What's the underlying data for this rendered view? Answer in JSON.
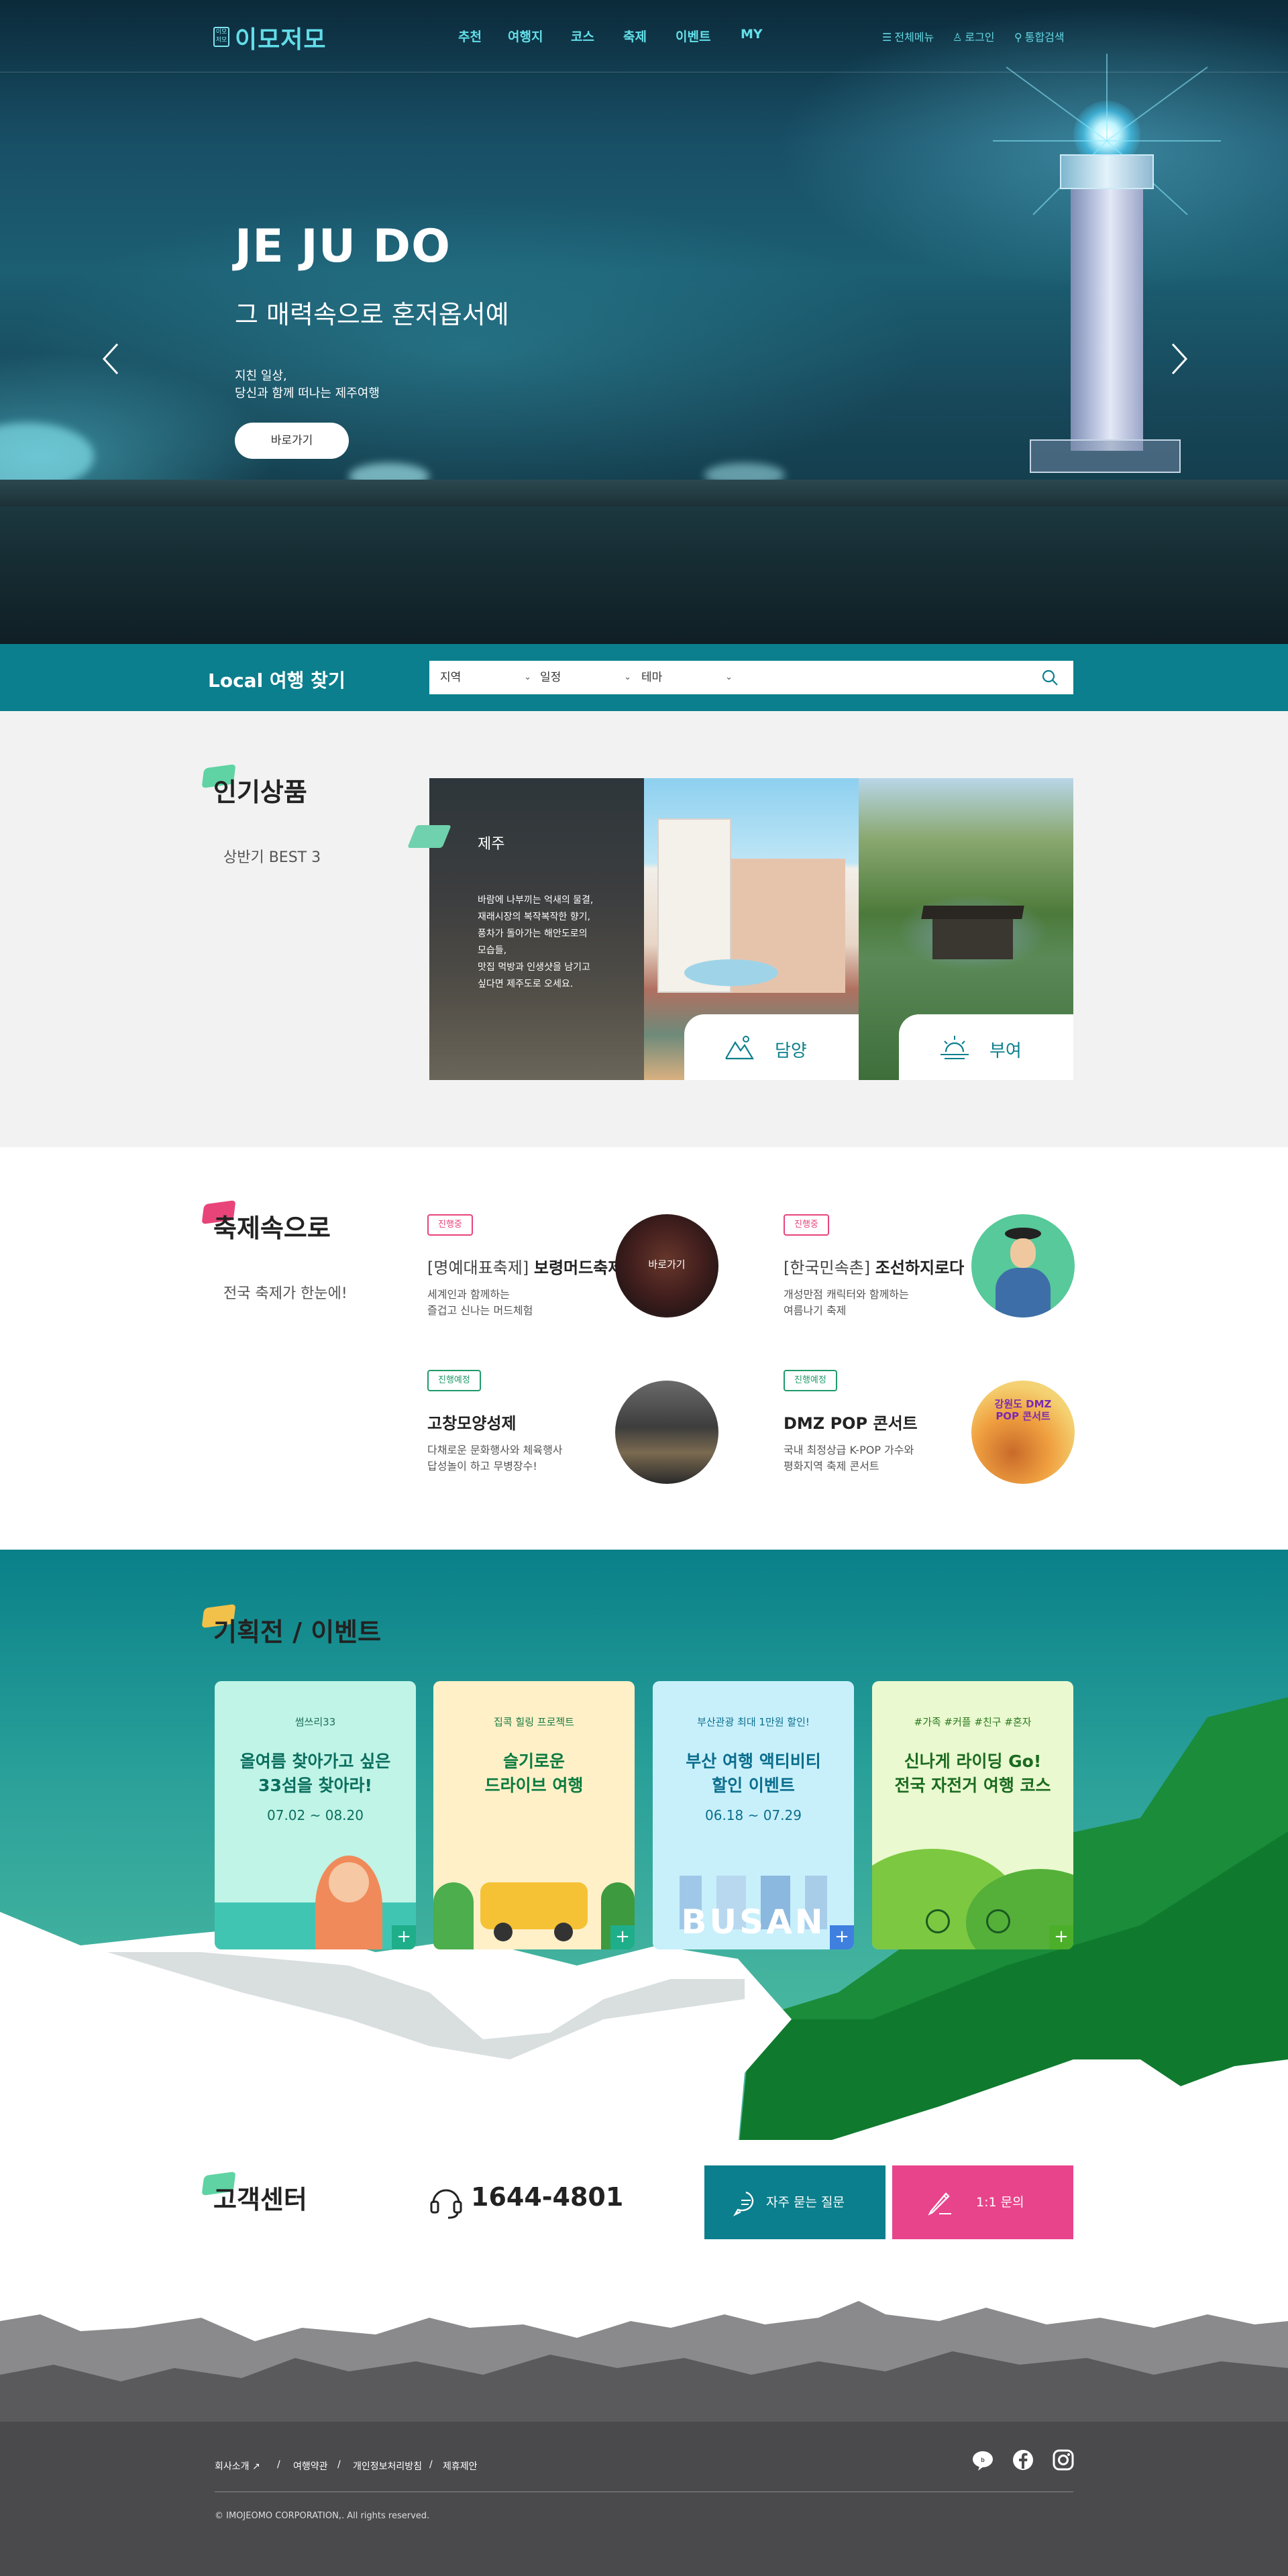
{
  "header": {
    "logo_mark": "이모\n저모",
    "logo_text": "이모저모",
    "nav": [
      "추천",
      "여행지",
      "코스",
      "축제",
      "이벤트",
      "MY"
    ],
    "util": {
      "menu": "전체메뉴",
      "login": "로그인",
      "search": "통합검색"
    }
  },
  "hero": {
    "title": "JE JU DO",
    "subtitle": "그 매력속으로 혼저옵서예",
    "desc_line1": "지친 일상,",
    "desc_line2": "당신과 함께 떠나는 제주여행",
    "button": "바로가기"
  },
  "search": {
    "title": "Local 여행 찾기",
    "selects": [
      "지역",
      "일정",
      "테마"
    ]
  },
  "popular": {
    "title": "인기상품",
    "subtitle": "상반기 BEST 3",
    "featured": {
      "title": "제주",
      "lines": [
        "바람에 나부끼는 억새의 물결,",
        "재래시장의 복작복작한 향기,",
        "풍차가 돌아가는 해안도로의",
        "모습들,",
        "맛집 먹방과 인생샷을 남기고",
        "싶다면 제주도로 오세요."
      ]
    },
    "cards": [
      {
        "label": "담양",
        "icon": "mountain-icon"
      },
      {
        "label": "부여",
        "icon": "sunrise-icon"
      }
    ]
  },
  "festival": {
    "title": "축제속으로",
    "subtitle": "전국 축제가 한눈에!",
    "items": [
      {
        "tag": "진행중",
        "prefix": "[명예대표축제]",
        "name": "보령머드축제",
        "desc1": "세계인과 함께하는",
        "desc2": "즐겁고 신나는 머드체험",
        "overlay": "바로가기"
      },
      {
        "tag": "진행중",
        "prefix": "[한국민속촌]",
        "name": "조선하지로다",
        "desc1": "개성만점 캐릭터와 함께하는",
        "desc2": "여름나기 축제"
      },
      {
        "tag": "진행예정",
        "prefix": "",
        "name": "고창모양성제",
        "desc1": "다채로운 문화행사와 체육행사",
        "desc2": "답성놀이 하고 무병장수!"
      },
      {
        "tag": "진행예정",
        "prefix": "",
        "name": "DMZ POP 콘서트",
        "desc1": "국내 최정상급 K-POP 가수와",
        "desc2": "평화지역 축제 콘서트"
      }
    ],
    "dmz_poster": {
      "line1": "강원도 DMZ",
      "line2": "POP 콘서트"
    },
    "colors": {
      "ongoing": "#e8447a",
      "upcoming": "#1f9a6a"
    }
  },
  "events": {
    "title": "기획전 / 이벤트",
    "cards": [
      {
        "tag": "썸쓰리33",
        "title1": "올여름 찾아가고 싶은",
        "title2": "33섬을 찾아라!",
        "date": "07.02 ~ 08.20",
        "bg": "#bff4e6"
      },
      {
        "tag": "집콕 힐링 프로젝트",
        "title1": "슬기로운",
        "title2": "드라이브 여행",
        "date": "",
        "bg": "#fff0c8"
      },
      {
        "tag": "부산관광 최대 1만원 할인!",
        "title1": "부산 여행 액티비티",
        "title2": "할인 이벤트",
        "date": "06.18 ~ 07.29",
        "bg": "#c8f0fb",
        "bottom": "BUSAN"
      },
      {
        "tag": "#가족 #커플 #친구 #혼자",
        "title1": "신나게 라이딩 Go!",
        "title2": "전국 자전거 여행 코스",
        "date": "",
        "bg": "#eaf9cf"
      }
    ],
    "plus": "+"
  },
  "cs": {
    "title": "고객센터",
    "phone": "1644-4801",
    "faq": "자주 묻는 질문",
    "qna": "1:1 문의",
    "colors": {
      "faq": "#0b7f8d",
      "qna": "#e8448c"
    }
  },
  "footer": {
    "links": [
      "회사소개",
      "여행약관",
      "개인정보처리방침",
      "제휴제안"
    ],
    "sep": "/",
    "copyright": "© IMOJEOMO CORPORATION,. All rights reserved."
  }
}
